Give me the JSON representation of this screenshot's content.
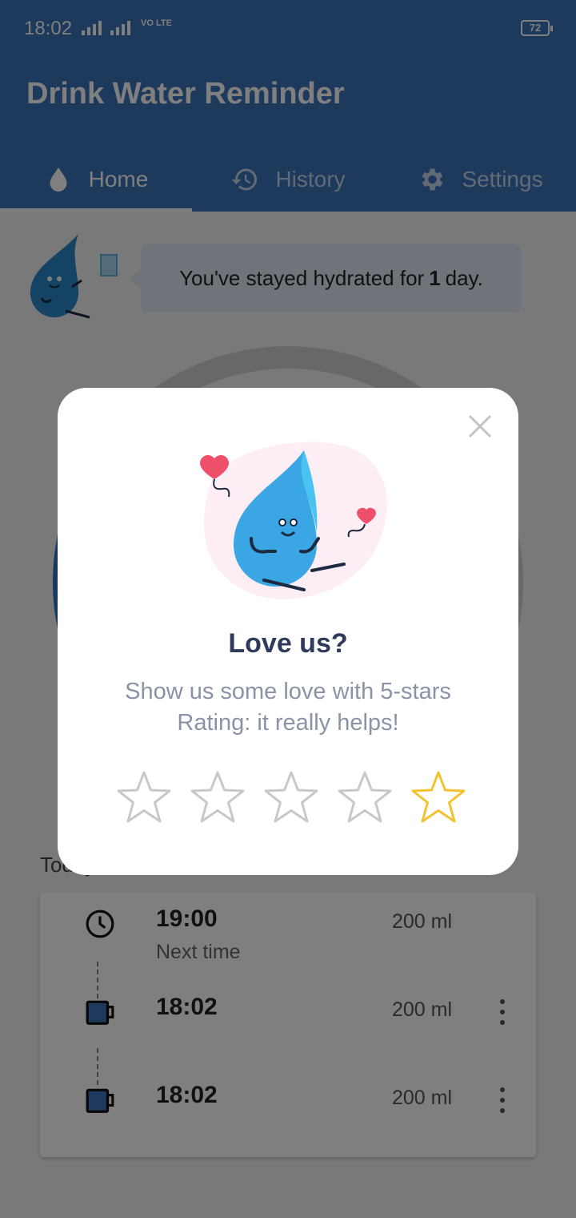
{
  "status_bar": {
    "time": "18:02",
    "network": "VO LTE",
    "battery": "72"
  },
  "app": {
    "title": "Drink Water Reminder"
  },
  "tabs": [
    {
      "label": "Home",
      "icon": "water-drop-icon",
      "active": true
    },
    {
      "label": "History",
      "icon": "history-icon",
      "active": false
    },
    {
      "label": "Settings",
      "icon": "gear-icon",
      "active": false
    }
  ],
  "streak": {
    "prefix": "You've stayed hydrated for",
    "count": "1",
    "suffix": "day."
  },
  "today": {
    "label": "Today",
    "entries": [
      {
        "time": "19:00",
        "subtitle": "Next time",
        "amount": "200 ml",
        "icon": "clock-icon"
      },
      {
        "time": "18:02",
        "amount": "200 ml",
        "icon": "cup-icon"
      },
      {
        "time": "18:02",
        "amount": "200 ml",
        "icon": "cup-icon"
      }
    ]
  },
  "rating_dialog": {
    "title": "Love us?",
    "line1": "Show us some love with 5-stars",
    "line2": "Rating: it really helps!",
    "stars_total": 5,
    "highlighted_star": 5,
    "colors": {
      "star_highlight": "#f2c230",
      "star_outline": "#c8c8c8",
      "title": "#2f3b5a",
      "body": "#8a93a6"
    }
  },
  "colors": {
    "app_bar": "#3a73b8",
    "progress": "#2a72c4"
  }
}
